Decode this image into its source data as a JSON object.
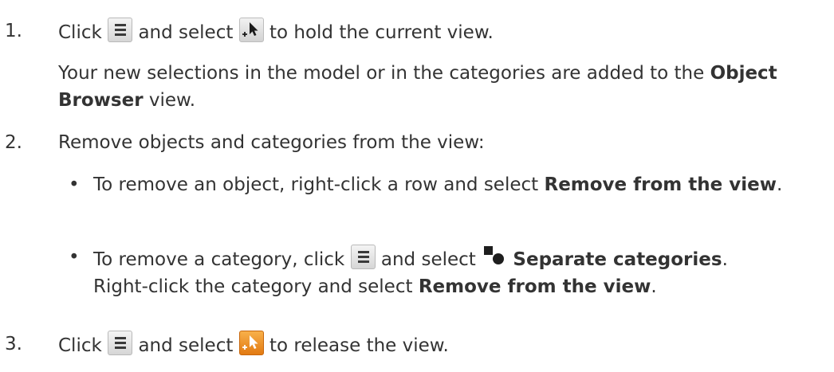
{
  "step1": {
    "number": "1.",
    "part1": "Click",
    "part2": "and select",
    "part3": "to hold the current view.",
    "note_part1": "Your new selections in the model or in the categories are added to the",
    "note_bold": "Object Browser",
    "note_part2": "view."
  },
  "step2": {
    "number": "2.",
    "text": "Remove objects and categories from the view:",
    "bullets": [
      {
        "marker": "•",
        "part1": "To remove an object, right-click a row and select",
        "bold": "Remove from the view",
        "part2": "."
      },
      {
        "marker": "•",
        "part1": "To remove a category, click",
        "part2": "and select",
        "bold1": "Separate categories",
        "part3": ".",
        "line2_part1": "Right-click the category and select",
        "bold2": "Remove from the view",
        "line2_part2": "."
      }
    ]
  },
  "step3": {
    "number": "3.",
    "part1": "Click",
    "part2": "and select",
    "part3": "to release the view."
  },
  "icons": {
    "menu": "menu-icon",
    "hold_view": "hold-view-icon",
    "release_view": "release-view-icon",
    "separate_categories": "separate-categories-icon"
  },
  "colors": {
    "text": "#333333",
    "release_icon": "#f29a2e"
  }
}
